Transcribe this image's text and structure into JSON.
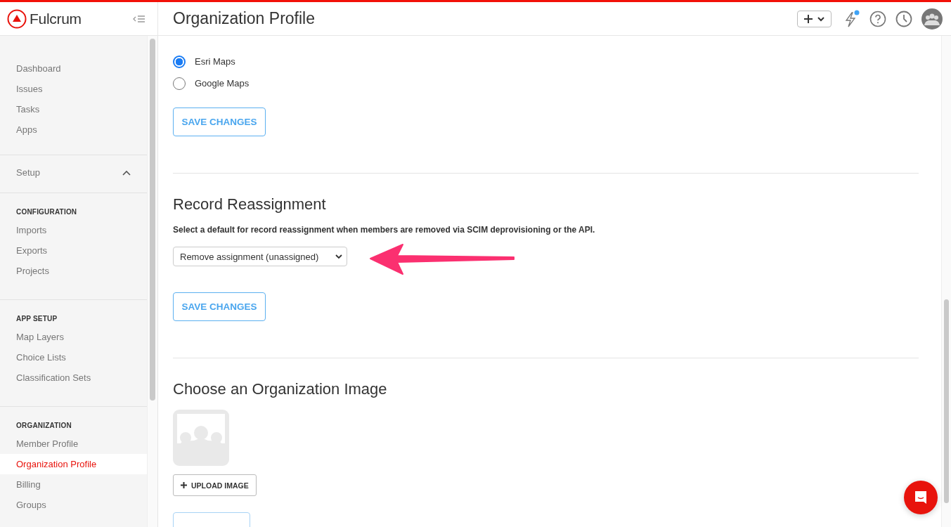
{
  "app": {
    "name": "Fulcrum"
  },
  "header": {
    "title": "Organization Profile",
    "has_notification": true
  },
  "sidebar": {
    "main_items": [
      {
        "label": "Dashboard",
        "selected": false
      },
      {
        "label": "Issues",
        "selected": false
      },
      {
        "label": "Tasks",
        "selected": false
      },
      {
        "label": "Apps",
        "selected": false
      }
    ],
    "setup": {
      "label": "Setup",
      "expanded": true
    },
    "sections": [
      {
        "heading": "CONFIGURATION",
        "items": [
          {
            "label": "Imports",
            "selected": false
          },
          {
            "label": "Exports",
            "selected": false
          },
          {
            "label": "Projects",
            "selected": false
          }
        ]
      },
      {
        "heading": "APP SETUP",
        "items": [
          {
            "label": "Map Layers",
            "selected": false
          },
          {
            "label": "Choice Lists",
            "selected": false
          },
          {
            "label": "Classification Sets",
            "selected": false
          }
        ]
      },
      {
        "heading": "ORGANIZATION",
        "items": [
          {
            "label": "Member Profile",
            "selected": false
          },
          {
            "label": "Organization Profile",
            "selected": true
          },
          {
            "label": "Billing",
            "selected": false
          },
          {
            "label": "Groups",
            "selected": false
          }
        ]
      }
    ]
  },
  "map_engine": {
    "options": [
      {
        "label": "Esri Maps",
        "selected": true
      },
      {
        "label": "Google Maps",
        "selected": false
      }
    ],
    "button": "SAVE CHANGES"
  },
  "record_reassignment": {
    "title": "Record Reassignment",
    "description": "Select a default for record reassignment when members are removed via SCIM deprovisioning or the API.",
    "select": {
      "value": "Remove assignment (unassigned)"
    },
    "button": "SAVE CHANGES"
  },
  "organization_image": {
    "title": "Choose an Organization Image",
    "button": "UPLOAD IMAGE"
  }
}
